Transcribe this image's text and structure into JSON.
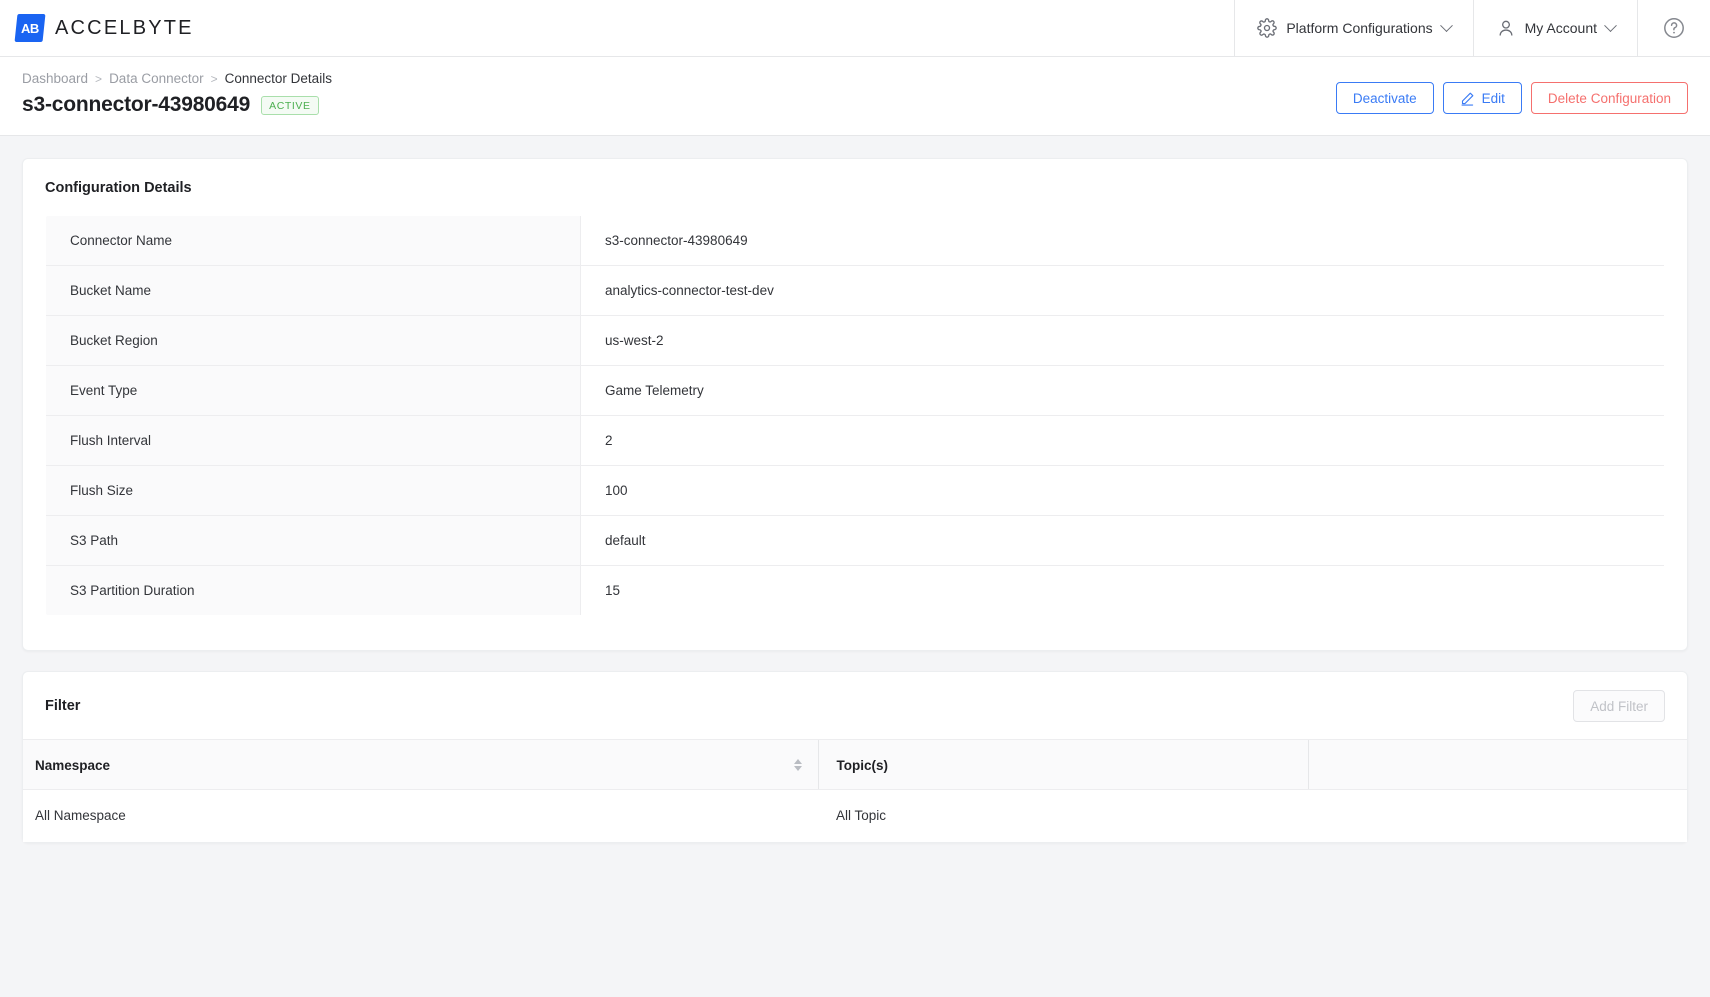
{
  "topbar": {
    "brand_mark": "AB",
    "brand_word": "ACCELBYTE",
    "nav": [
      {
        "label": "Platform Configurations",
        "icon": "gear-icon"
      },
      {
        "label": "My Account",
        "icon": "user-icon"
      }
    ],
    "help_icon": "help-circle-icon"
  },
  "pagehead": {
    "breadcrumb": [
      {
        "label": "Dashboard"
      },
      {
        "label": "Data Connector"
      },
      {
        "label": "Connector Details"
      }
    ],
    "separator": ">",
    "title": "s3-connector-43980649",
    "status_badge": "ACTIVE",
    "buttons": {
      "deactivate": "Deactivate",
      "edit": "Edit",
      "delete": "Delete Configuration"
    }
  },
  "config_card": {
    "title": "Configuration Details",
    "rows": [
      {
        "label": "Connector Name",
        "value": "s3-connector-43980649"
      },
      {
        "label": "Bucket Name",
        "value": "analytics-connector-test-dev"
      },
      {
        "label": "Bucket Region",
        "value": "us-west-2"
      },
      {
        "label": "Event Type",
        "value": "Game Telemetry"
      },
      {
        "label": "Flush Interval",
        "value": "2"
      },
      {
        "label": "Flush Size",
        "value": "100"
      },
      {
        "label": "S3 Path",
        "value": "default"
      },
      {
        "label": "S3 Partition Duration",
        "value": "15"
      }
    ]
  },
  "filter_card": {
    "title": "Filter",
    "add_button": "Add Filter",
    "columns": [
      "Namespace",
      "Topic(s)",
      ""
    ],
    "rows": [
      {
        "namespace": "All Namespace",
        "topics": "All Topic"
      }
    ]
  },
  "colors": {
    "accent_blue": "#3a7bf5",
    "brand_blue": "#1a64f2",
    "danger_red": "#f5706e",
    "status_green": "#4caf50",
    "page_bg": "#f4f5f7"
  }
}
